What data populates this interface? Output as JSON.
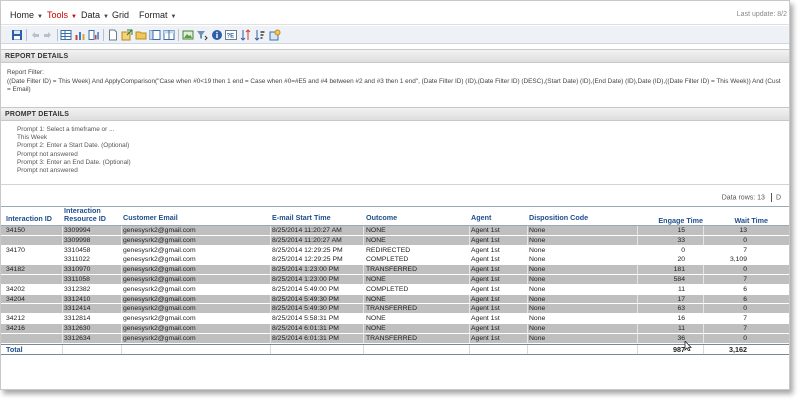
{
  "menu": {
    "items": [
      {
        "label": "Home"
      },
      {
        "label": "Tools"
      },
      {
        "label": "Data"
      },
      {
        "label": "Grid"
      },
      {
        "label": "Format"
      }
    ],
    "last_update": "Last update: 8/2"
  },
  "toolbar": {
    "icons": [
      "save-icon",
      "undo-icon",
      "redo-icon",
      "grid-view-icon",
      "chart-view-icon",
      "grid-chart-icon",
      "page-icon",
      "export-icon",
      "folder-icon",
      "pivot-icon",
      "table-icon",
      "picture-icon",
      "filter-icon",
      "info-icon",
      "format-icon",
      "sort-icon",
      "sort-asc-icon",
      "settings-icon"
    ]
  },
  "report_details": {
    "heading": "REPORT DETAILS",
    "filter_label": "Report Filter:",
    "filter_text": "((Date Filter ID) = This Week) And ApplyComparison(\"Case when #0<19  then 1 end = Case when #0=#E5 and #4 between #2 and #3 then 1 end\", (Date Filter ID) (ID),(Date Filter ID) (DESC),(Start Date) (ID),(End Date) (ID),Date (ID),((Date Filter ID) = This Week)) And (Cust",
    "filter_text_2": "= Email)"
  },
  "prompt_details": {
    "heading": "PROMPT DETAILS",
    "lines": [
      "Prompt 1: Select a timeframe or ...",
      "This Week",
      "Prompt 2: Enter a  Start Date. (Optional)",
      "Prompt not answered",
      "Prompt 3: Enter an End Date. (Optional)",
      "Prompt not answered"
    ]
  },
  "grid": {
    "data_rows": "Data rows: 13",
    "data_rows_suffix": "D",
    "columns": [
      {
        "label_1": "Interaction ID",
        "label_2": ""
      },
      {
        "label_1": "Interaction",
        "label_2": "Resource ID"
      },
      {
        "label_1": "Customer Email",
        "label_2": ""
      },
      {
        "label_1": "E-mail Start Time",
        "label_2": ""
      },
      {
        "label_1": "Outcome",
        "label_2": ""
      },
      {
        "label_1": "Agent",
        "label_2": ""
      },
      {
        "label_1": "Disposition Code",
        "label_2": ""
      },
      {
        "label_1": "Engage Time",
        "label_2": ""
      },
      {
        "label_1": "Wait Time",
        "label_2": ""
      }
    ],
    "rows": [
      {
        "id": "34150",
        "res": "3309994",
        "email": "genesysrk2@gmail.com",
        "start": "8/25/2014 11:20:27 AM",
        "outcome": "NONE",
        "agent": "Agent 1st",
        "disp": "None",
        "engage": "15",
        "wait": "13",
        "shade": true
      },
      {
        "id": "",
        "res": "3309998",
        "email": "genesysrk2@gmail.com",
        "start": "8/25/2014 11:20:27 AM",
        "outcome": "NONE",
        "agent": "Agent 1st",
        "disp": "None",
        "engage": "33",
        "wait": "0",
        "shade": true
      },
      {
        "id": "34170",
        "res": "3310458",
        "email": "genesysrk2@gmail.com",
        "start": "8/25/2014 12:29:25 PM",
        "outcome": "REDIRECTED",
        "agent": "Agent 1st",
        "disp": "None",
        "engage": "0",
        "wait": "7",
        "shade": false
      },
      {
        "id": "",
        "res": "3311022",
        "email": "genesysrk2@gmail.com",
        "start": "8/25/2014 12:29:25 PM",
        "outcome": "COMPLETED",
        "agent": "Agent 1st",
        "disp": "None",
        "engage": "20",
        "wait": "3,109",
        "shade": false
      },
      {
        "id": "34182",
        "res": "3310970",
        "email": "genesysrk2@gmail.com",
        "start": "8/25/2014 1:23:00 PM",
        "outcome": "TRANSFERRED",
        "agent": "Agent 1st",
        "disp": "None",
        "engage": "181",
        "wait": "0",
        "shade": true
      },
      {
        "id": "",
        "res": "3311058",
        "email": "genesysrk2@gmail.com",
        "start": "8/25/2014 1:23:00 PM",
        "outcome": "NONE",
        "agent": "Agent 1st",
        "disp": "None",
        "engage": "584",
        "wait": "7",
        "shade": true
      },
      {
        "id": "34202",
        "res": "3312382",
        "email": "genesysrk2@gmail.com",
        "start": "8/25/2014 5:49:00 PM",
        "outcome": "COMPLETED",
        "agent": "Agent 1st",
        "disp": "None",
        "engage": "11",
        "wait": "6",
        "shade": false
      },
      {
        "id": "34204",
        "res": "3312410",
        "email": "genesysrk2@gmail.com",
        "start": "8/25/2014 5:49:30 PM",
        "outcome": "NONE",
        "agent": "Agent 1st",
        "disp": "None",
        "engage": "17",
        "wait": "6",
        "shade": true
      },
      {
        "id": "",
        "res": "3312414",
        "email": "genesysrk2@gmail.com",
        "start": "8/25/2014 5:49:30 PM",
        "outcome": "TRANSFERRED",
        "agent": "Agent 1st",
        "disp": "None",
        "engage": "63",
        "wait": "0",
        "shade": true
      },
      {
        "id": "34212",
        "res": "3312814",
        "email": "genesysrk2@gmail.com",
        "start": "8/25/2014 5:58:31 PM",
        "outcome": "NONE",
        "agent": "Agent 1st",
        "disp": "None",
        "engage": "16",
        "wait": "7",
        "shade": false
      },
      {
        "id": "34216",
        "res": "3312630",
        "email": "genesysrk2@gmail.com",
        "start": "8/25/2014 6:01:31 PM",
        "outcome": "NONE",
        "agent": "Agent 1st",
        "disp": "None",
        "engage": "11",
        "wait": "7",
        "shade": true
      },
      {
        "id": "",
        "res": "3312634",
        "email": "genesysrk2@gmail.com",
        "start": "8/25/2014 6:01:31 PM",
        "outcome": "TRANSFERRED",
        "agent": "Agent 1st",
        "disp": "None",
        "engage": "36",
        "wait": "0",
        "shade": true
      }
    ],
    "total": {
      "label": "Total",
      "engage": "987",
      "wait": "3,162"
    }
  }
}
